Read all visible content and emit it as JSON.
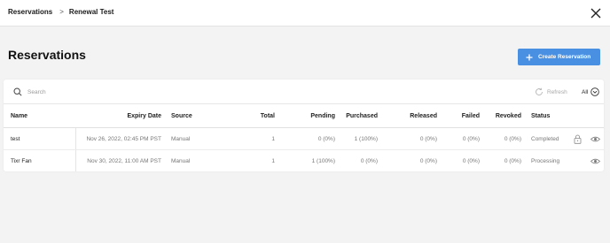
{
  "breadcrumb": {
    "root": "Reservations",
    "separator": ">",
    "current": "Renewal Test"
  },
  "page": {
    "title": "Reservations"
  },
  "create_button": {
    "label": "Create Reservation"
  },
  "search": {
    "placeholder": "Search",
    "value": ""
  },
  "refresh": {
    "label": "Refresh"
  },
  "filter": {
    "selected": "All"
  },
  "table": {
    "columns": [
      "Name",
      "Expiry Date",
      "Source",
      "Total",
      "Pending",
      "Purchased",
      "Released",
      "Failed",
      "Revoked",
      "Status"
    ],
    "rows": [
      {
        "name": "test",
        "expiry": "Nov 26, 2022, 02:45 PM PST",
        "source": "Manual",
        "total": "1",
        "pending": "0 (0%)",
        "purchased": "1 (100%)",
        "released": "0 (0%)",
        "failed": "0 (0%)",
        "revoked": "0 (0%)",
        "status": "Completed",
        "icons": [
          "lock-icon",
          "eye-icon"
        ]
      },
      {
        "name": "Tixr Fan",
        "expiry": "Nov 30, 2022, 11:00 AM PST",
        "source": "Manual",
        "total": "1",
        "pending": "1 (100%)",
        "purchased": "0 (0%)",
        "released": "0 (0%)",
        "failed": "0 (0%)",
        "revoked": "0 (0%)",
        "status": "Processing",
        "icons": [
          "eye-icon"
        ]
      }
    ]
  },
  "colors": {
    "accent": "#4a90e2",
    "background": "#f3f3f3"
  }
}
